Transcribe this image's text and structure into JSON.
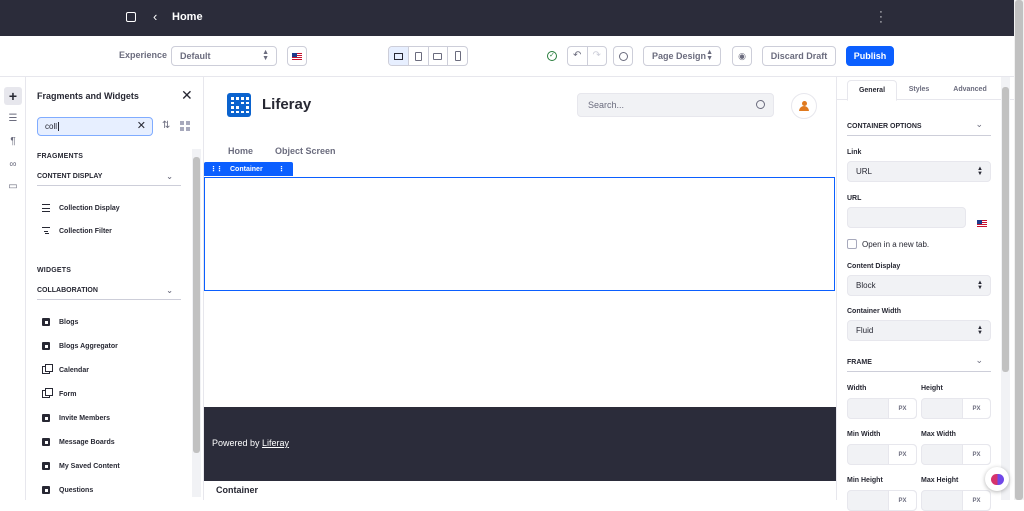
{
  "topbar": {
    "title": "Home",
    "back_icon": "chevron-left-icon",
    "menu_icon": "kebab-icon"
  },
  "toolbar": {
    "experience_label": "Experience",
    "experience_value": "Default",
    "page_design_label": "Page Design",
    "discard_label": "Discard Draft",
    "publish_label": "Publish"
  },
  "panel": {
    "title": "Fragments and Widgets",
    "search_value": "coll",
    "fragments_heading": "FRAGMENTS",
    "content_display_group": "CONTENT DISPLAY",
    "fragment_items": [
      "Collection Display",
      "Collection Filter"
    ],
    "widgets_heading": "WIDGETS",
    "collaboration_group": "COLLABORATION",
    "widget_items": [
      "Blogs",
      "Blogs Aggregator",
      "Calendar",
      "Form",
      "Invite Members",
      "Message Boards",
      "My Saved Content",
      "Questions"
    ]
  },
  "canvas": {
    "brand": "Liferay",
    "search_placeholder": "Search...",
    "nav": [
      "Home",
      "Object Screen"
    ],
    "container_label": "Container",
    "footer_prefix": "Powered by ",
    "footer_link": "Liferay",
    "breadcrumb_bottom": "Container"
  },
  "right": {
    "tabs": [
      "General",
      "Styles",
      "Advanced"
    ],
    "container_options": "CONTAINER OPTIONS",
    "link_label": "Link",
    "link_value": "URL",
    "url_label": "URL",
    "new_tab_label": "Open in a new tab.",
    "content_display_label": "Content Display",
    "content_display_value": "Block",
    "container_width_label": "Container Width",
    "container_width_value": "Fluid",
    "frame_heading": "FRAME",
    "width_label": "Width",
    "height_label": "Height",
    "min_width_label": "Min Width",
    "max_width_label": "Max Width",
    "min_height_label": "Min Height",
    "max_height_label": "Max Height",
    "unit": "PX"
  },
  "colors": {
    "accent": "#0b5fff",
    "topbar": "#2b2c3a",
    "footer": "#2b2c3a",
    "avatar": "#e07a1f",
    "success": "#287d3c"
  }
}
